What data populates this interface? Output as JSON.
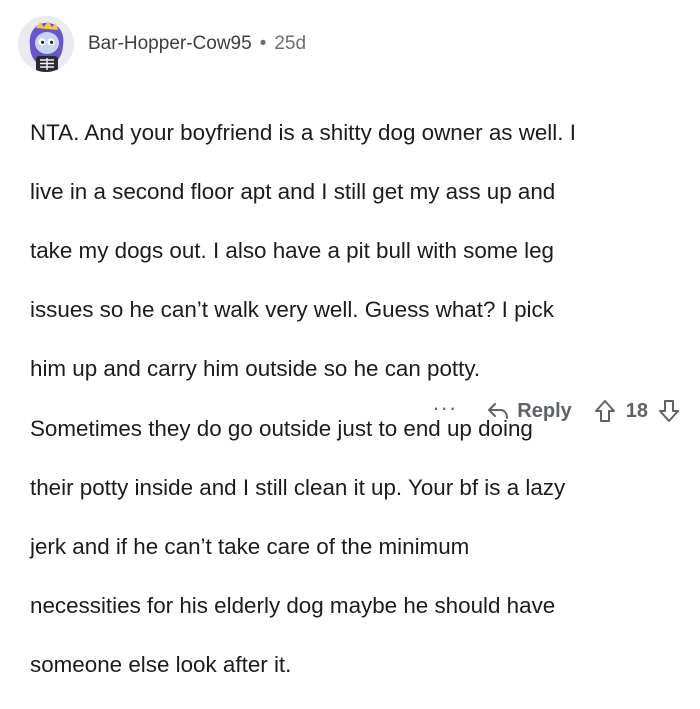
{
  "comment": {
    "author": "Bar-Hopper-Cow95",
    "separator": "•",
    "age": "25d",
    "lines": [
      "NTA. And your boyfriend is a shitty dog owner as well. I",
      "live in a second floor apt and I still get my ass up and",
      "take my dogs out. I also have a pit bull with some leg",
      "issues so he can’t walk very well. Guess what? I pick",
      "him up and carry him outside so he can potty.",
      "Sometimes they do go outside just to end up doing",
      "their potty inside and I still clean it up. Your bf is a lazy",
      "jerk and if he can’t take care of the minimum",
      "necessities for his elderly dog maybe he should have",
      "someone else look after it."
    ]
  },
  "actions": {
    "more": "···",
    "reply_label": "Reply",
    "vote_count": "18"
  },
  "icons": {
    "avatar": "avatar-icon",
    "reply": "reply-arrow-icon",
    "upvote": "upvote-arrow-icon",
    "downvote": "downvote-arrow-icon"
  },
  "colors": {
    "avatar_bg": "#e9ebf0",
    "avatar_character": "#6a55c9",
    "text": "#1c1c1c",
    "muted": "#6b6f73"
  }
}
